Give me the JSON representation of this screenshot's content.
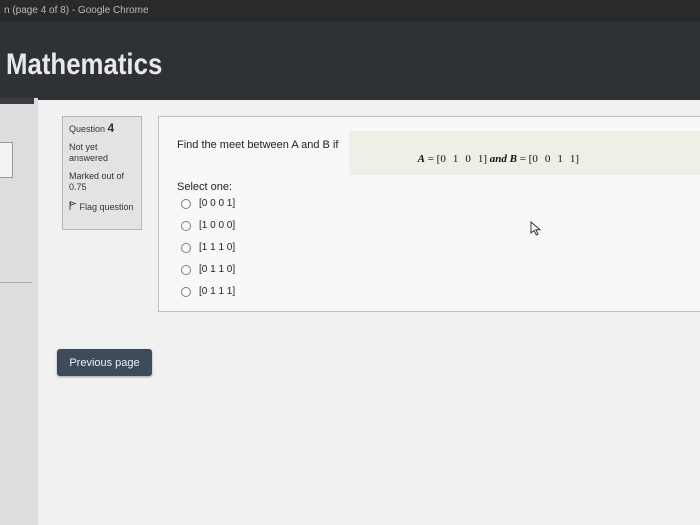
{
  "window": {
    "title": "n (page 4 of 8) - Google Chrome"
  },
  "header": {
    "site_title": "Mathematics"
  },
  "question_info": {
    "prefix": "Question",
    "number": "4",
    "state": "Not yet answered",
    "grade": "Marked out of 0.75",
    "flag_label": "Flag question",
    "flag_icon": "flag-icon"
  },
  "question": {
    "text": "Find the meet between A and B if",
    "formula": {
      "a_var": "A",
      "a_matrix": [
        "0",
        "1",
        "0",
        "1"
      ],
      "connector": "and",
      "b_var": "B",
      "b_matrix": [
        "0",
        "0",
        "1",
        "1"
      ]
    },
    "select_label": "Select one:",
    "options": [
      {
        "label": "[0 0 0 1]"
      },
      {
        "label": "[1 0 0 0]"
      },
      {
        "label": "[1 1 1 0]"
      },
      {
        "label": "[0 1 1 0]"
      },
      {
        "label": "[0 1 1 1]"
      }
    ]
  },
  "navigation": {
    "previous_label": "Previous page"
  }
}
